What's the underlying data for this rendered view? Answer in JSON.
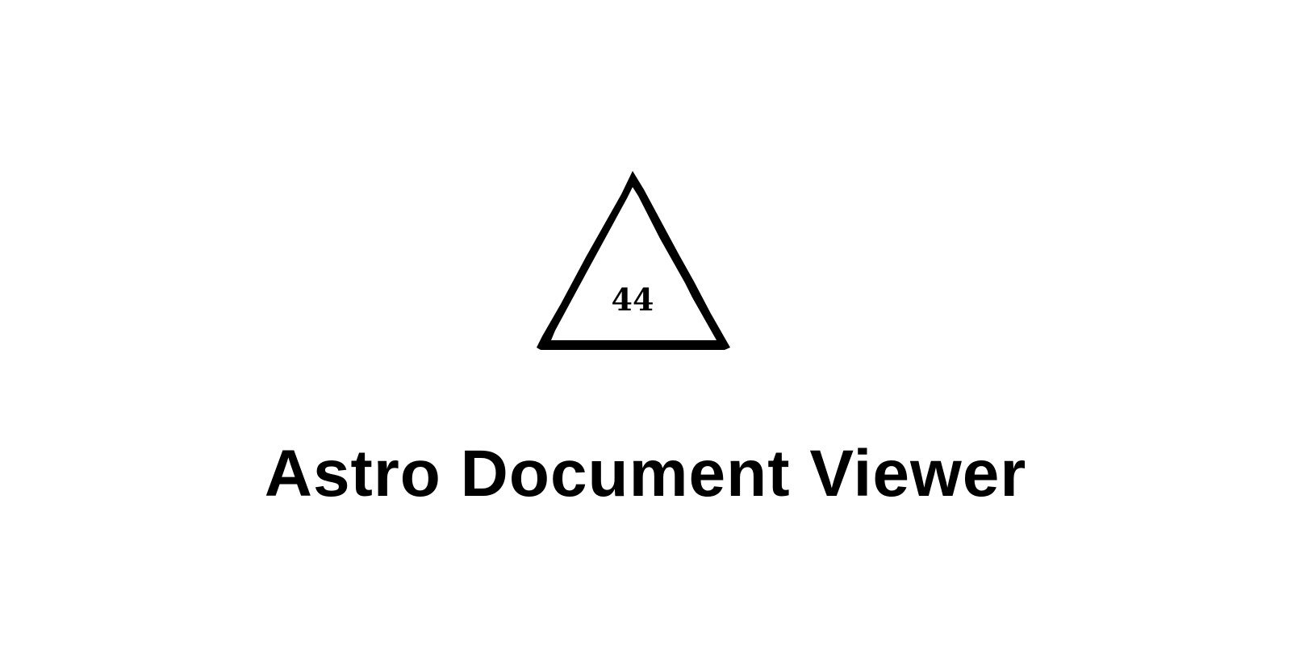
{
  "logo": {
    "icon": "triangle-logo-icon",
    "number": "44",
    "color": "#000000"
  },
  "app": {
    "title": "Astro Document Viewer"
  },
  "colors": {
    "background": "#ffffff",
    "text": "#000000"
  }
}
